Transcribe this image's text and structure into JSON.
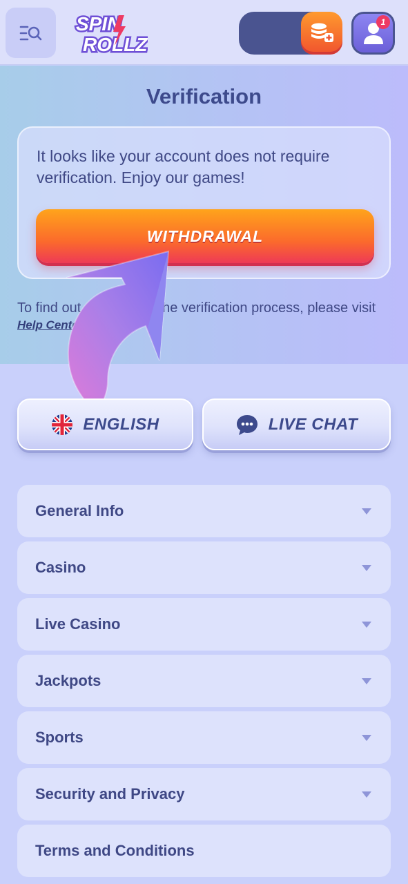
{
  "header": {
    "logo_line1": "SPIN",
    "logo_line2": "ROLLZ",
    "notification_count": "1",
    "icons": {
      "menu": "menu-search-icon",
      "deposit": "coins-plus-icon",
      "profile": "user-icon"
    }
  },
  "verification": {
    "title": "Verification",
    "message": "It looks like your account does not require verification. Enjoy our games!",
    "withdraw_label": "WITHDRAWAL",
    "help_text_before": "To find out more about the verification process, please visit",
    "help_link": "Help Center"
  },
  "actions": {
    "language_label": "ENGLISH",
    "language_icon": "uk-flag-icon",
    "chat_label": "LIVE CHAT",
    "chat_icon": "chat-bubble-icon"
  },
  "accordion": [
    {
      "label": "General Info"
    },
    {
      "label": "Casino"
    },
    {
      "label": "Live Casino"
    },
    {
      "label": "Jackpots"
    },
    {
      "label": "Sports"
    },
    {
      "label": "Security and Privacy"
    },
    {
      "label": "Terms and Conditions"
    }
  ],
  "colors": {
    "accent_orange": "#fb6a2c",
    "accent_purple": "#6b5fd8",
    "text_primary": "#3f4885"
  }
}
